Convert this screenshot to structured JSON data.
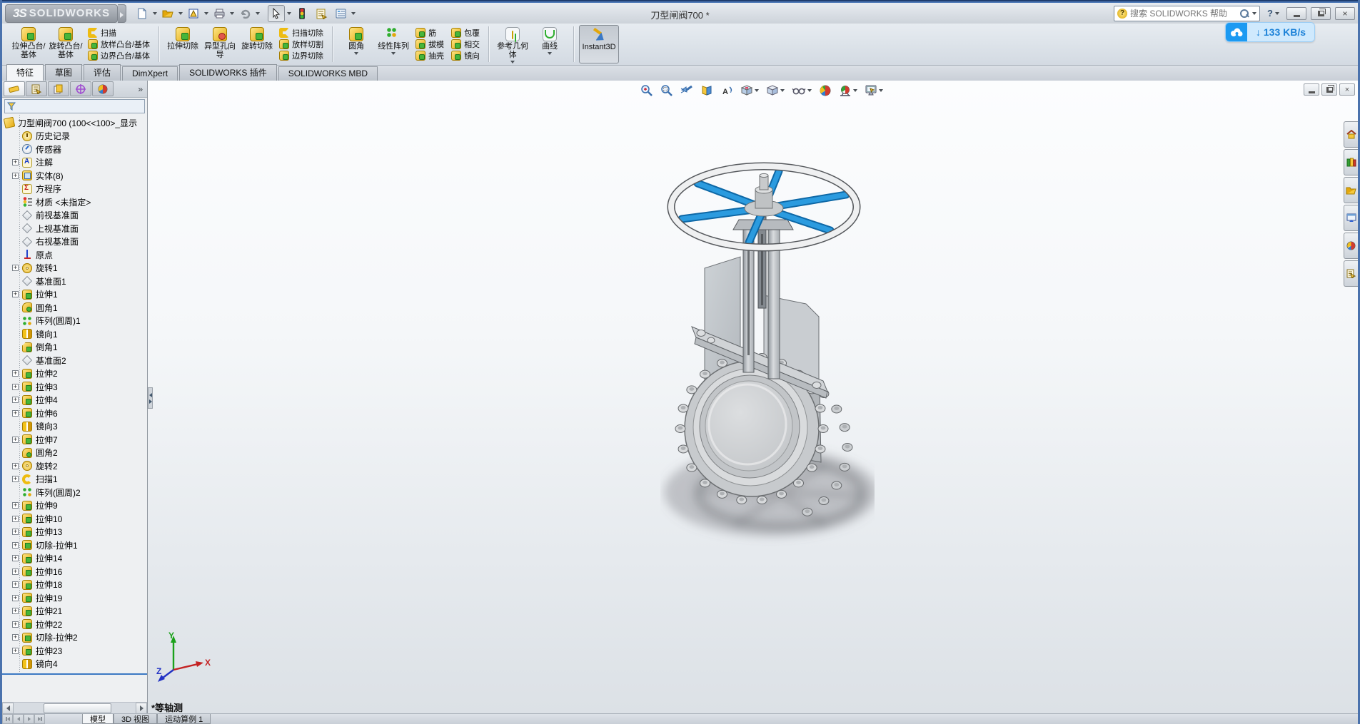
{
  "titlebar": {
    "logo_mark": "3S",
    "logo_text": "SOLIDWORKS",
    "title": "刀型闸阀700 *",
    "search_placeholder": "搜索 SOLIDWORKS 帮助",
    "help_label": "?",
    "quick_tool_icons": [
      "new-document-icon",
      "open-icon",
      "make-drawing-icon",
      "print-icon",
      "undo-icon",
      "select-icon",
      "rebuild-stoplight-icon",
      "file-properties-icon",
      "options-icon"
    ]
  },
  "netdisk_badge": {
    "icon": "baidu-netdisk-cloud-icon",
    "speed": "↓ 133 KB/s"
  },
  "ribbon": {
    "groups": [
      {
        "large": [
          {
            "label": "拉伸凸台/基体",
            "icon": "boss-extrude"
          },
          {
            "label": "旋转凸台/基体",
            "icon": "revolve-boss"
          }
        ],
        "stacks": [
          [
            {
              "label": "扫描",
              "icon": "sweep"
            },
            {
              "label": "放样凸台/基体",
              "icon": "loft"
            },
            {
              "label": "边界凸台/基体",
              "icon": "boundary"
            }
          ]
        ]
      },
      {
        "large": [
          {
            "label": "拉伸切除",
            "icon": "cut-extrude"
          },
          {
            "label": "异型孔向导",
            "icon": "hole-wizard"
          },
          {
            "label": "旋转切除",
            "icon": "revolve-cut"
          }
        ],
        "stacks": [
          [
            {
              "label": "扫描切除",
              "icon": "swept-cut"
            },
            {
              "label": "放样切割",
              "icon": "lofted-cut"
            },
            {
              "label": "边界切除",
              "icon": "boundary-cut"
            }
          ]
        ]
      },
      {
        "large": [
          {
            "label": "圆角",
            "icon": "fillet",
            "arrow": true
          },
          {
            "label": "线性阵列",
            "icon": "linear-pattern",
            "arrow": true
          }
        ],
        "stacks": [
          [
            {
              "label": "筋",
              "icon": "rib"
            },
            {
              "label": "拔模",
              "icon": "draft"
            },
            {
              "label": "抽壳",
              "icon": "shell"
            }
          ],
          [
            {
              "label": "包覆",
              "icon": "wrap"
            },
            {
              "label": "相交",
              "icon": "intersect"
            },
            {
              "label": "镜向",
              "icon": "mirror"
            }
          ]
        ]
      },
      {
        "large": [
          {
            "label": "参考几何体",
            "icon": "reference-geometry",
            "arrow": true
          },
          {
            "label": "曲线",
            "icon": "curves",
            "arrow": true
          }
        ]
      },
      {
        "large": [
          {
            "label": "Instant3D",
            "icon": "instant3d",
            "pressed": true
          }
        ]
      }
    ]
  },
  "command_tabs": {
    "active": "特征",
    "items": [
      "特征",
      "草图",
      "评估",
      "DimXpert",
      "SOLIDWORKS 插件",
      "SOLIDWORKS MBD"
    ]
  },
  "panel_tab_icons": [
    "featuremanager-icon",
    "propertymanager-icon",
    "configurationmanager-icon",
    "dimxpertmanager-icon",
    "displaymanager-icon"
  ],
  "feature_tree": {
    "root": "刀型闸阀700 (100<<100>_显示",
    "items": [
      {
        "label": "历史记录",
        "icon": "history",
        "expand": false
      },
      {
        "label": "传感器",
        "icon": "sensors",
        "expand": false
      },
      {
        "label": "注解",
        "icon": "annotations",
        "expand": true
      },
      {
        "label": "实体(8)",
        "icon": "bodies",
        "expand": true
      },
      {
        "label": "方程序",
        "icon": "equations",
        "expand": false
      },
      {
        "label": "材质 <未指定>",
        "icon": "material",
        "expand": false
      },
      {
        "label": "前视基准面",
        "icon": "plane",
        "expand": false
      },
      {
        "label": "上视基准面",
        "icon": "plane",
        "expand": false
      },
      {
        "label": "右视基准面",
        "icon": "plane",
        "expand": false
      },
      {
        "label": "原点",
        "icon": "origin",
        "expand": false
      },
      {
        "label": "旋转1",
        "icon": "revolve",
        "expand": true
      },
      {
        "label": "基准面1",
        "icon": "plane",
        "expand": false
      },
      {
        "label": "拉伸1",
        "icon": "extrude",
        "expand": true
      },
      {
        "label": "圆角1",
        "icon": "fillet",
        "expand": false
      },
      {
        "label": "阵列(圆周)1",
        "icon": "cirpattern",
        "expand": false
      },
      {
        "label": "镜向1",
        "icon": "mirror",
        "expand": false
      },
      {
        "label": "倒角1",
        "icon": "chamfer",
        "expand": false
      },
      {
        "label": "基准面2",
        "icon": "plane",
        "expand": false
      },
      {
        "label": "拉伸2",
        "icon": "extrude",
        "expand": true
      },
      {
        "label": "拉伸3",
        "icon": "extrude",
        "expand": true
      },
      {
        "label": "拉伸4",
        "icon": "extrude",
        "expand": true
      },
      {
        "label": "拉伸6",
        "icon": "extrude",
        "expand": true
      },
      {
        "label": "镜向3",
        "icon": "mirror",
        "expand": false
      },
      {
        "label": "拉伸7",
        "icon": "extrude",
        "expand": true
      },
      {
        "label": "圆角2",
        "icon": "fillet",
        "expand": false
      },
      {
        "label": "旋转2",
        "icon": "revolve",
        "expand": true
      },
      {
        "label": "扫描1",
        "icon": "sweep",
        "expand": true
      },
      {
        "label": "阵列(圆周)2",
        "icon": "cirpattern",
        "expand": false
      },
      {
        "label": "拉伸9",
        "icon": "extrude",
        "expand": true
      },
      {
        "label": "拉伸10",
        "icon": "extrude",
        "expand": true
      },
      {
        "label": "拉伸13",
        "icon": "extrude",
        "expand": true
      },
      {
        "label": "切除-拉伸1",
        "icon": "cut",
        "expand": true
      },
      {
        "label": "拉伸14",
        "icon": "extrude",
        "expand": true
      },
      {
        "label": "拉伸16",
        "icon": "extrude",
        "expand": true
      },
      {
        "label": "拉伸18",
        "icon": "extrude",
        "expand": true
      },
      {
        "label": "拉伸19",
        "icon": "extrude",
        "expand": true
      },
      {
        "label": "拉伸21",
        "icon": "extrude",
        "expand": true
      },
      {
        "label": "拉伸22",
        "icon": "extrude",
        "expand": true
      },
      {
        "label": "切除-拉伸2",
        "icon": "cut",
        "expand": true
      },
      {
        "label": "拉伸23",
        "icon": "extrude",
        "expand": true
      },
      {
        "label": "镜向4",
        "icon": "mirror",
        "expand": false
      }
    ]
  },
  "viewport": {
    "view_label": "*等轴测",
    "triad": {
      "x": "X",
      "y": "Y",
      "z": "Z"
    },
    "hud_icons": [
      "zoom-fit-icon",
      "zoom-area-icon",
      "previous-view-icon",
      "section-view-icon",
      "rotate-view-icon",
      "view-orientation-icon",
      "display-style-icon",
      "hide-show-items-icon",
      "edit-appearance-icon",
      "apply-scene-icon",
      "view-settings-icon"
    ]
  },
  "task_pane_icons": [
    "solidworks-resources-icon",
    "design-library-icon",
    "file-explorer-icon",
    "view-palette-icon",
    "appearances-scenes-icon",
    "custom-properties-icon"
  ],
  "bottom_tabs": {
    "active": "模型",
    "items": [
      "模型",
      "3D 视图",
      "运动算例 1"
    ]
  }
}
